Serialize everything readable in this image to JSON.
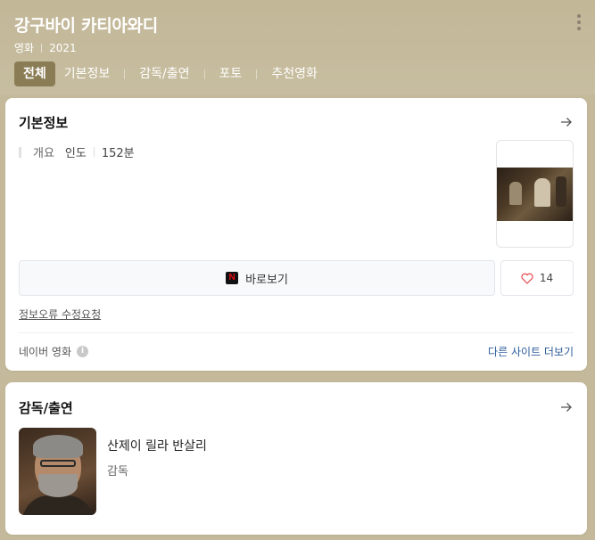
{
  "header": {
    "title": "강구바이 카티아와디",
    "meta": [
      "영화",
      "2021"
    ],
    "tabs": [
      {
        "label": "전체",
        "active": true
      },
      {
        "label": "기본정보",
        "active": false
      },
      {
        "label": "감독/출연",
        "active": false
      },
      {
        "label": "포토",
        "active": false
      },
      {
        "label": "추천영화",
        "active": false
      }
    ]
  },
  "basic_info": {
    "title": "기본정보",
    "overview_key": "개요",
    "country": "인도",
    "runtime": "152분",
    "watch_label": "바로보기",
    "like_count": "14",
    "report_label": "정보오류 수정요청",
    "source_label": "네이버 영화",
    "more_sites_label": "다른 사이트 더보기"
  },
  "cast": {
    "title": "감독/출연",
    "people": [
      {
        "name": "산제이 릴라 반살리",
        "role": "감독"
      }
    ]
  },
  "colors": {
    "header_bg": "#c4b99b",
    "active_tab": "#8a7c55",
    "link_blue": "#2d5c9a",
    "netflix_red": "#e50914"
  }
}
